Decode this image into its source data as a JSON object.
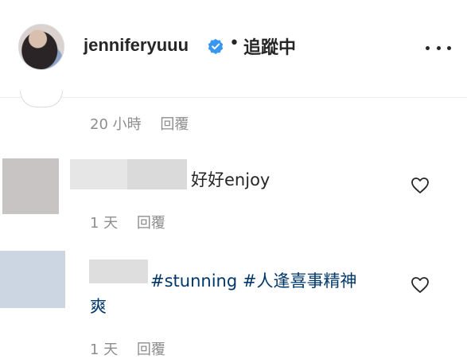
{
  "header": {
    "username": "jenniferyuuu",
    "separator": "•",
    "follow_state": "追蹤中"
  },
  "comments": [
    {
      "time": "20 小時",
      "reply_label": "回覆"
    },
    {
      "text": "好好enjoy",
      "time": "1 天",
      "reply_label": "回覆"
    },
    {
      "hashtags_line1": "#stunning #人逢喜事精神",
      "hashtags_line2": "爽",
      "time": "1 天",
      "reply_label": "回覆"
    }
  ],
  "icons": {
    "verified": "verified-badge-icon",
    "more": "more-options-icon",
    "heart": "heart-outline-icon"
  },
  "colors": {
    "verified_blue": "#3897f0",
    "hashtag": "#00376b",
    "meta_gray": "#8e8e8e",
    "text": "#262626"
  }
}
